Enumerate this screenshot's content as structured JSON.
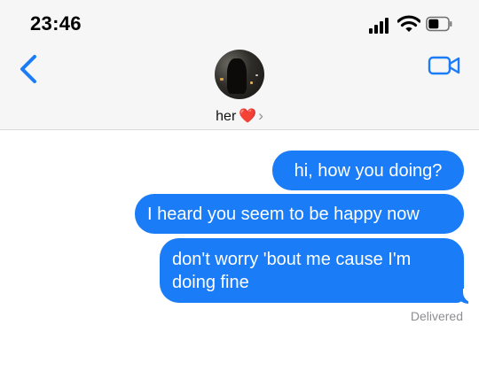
{
  "status_bar": {
    "time": "23:46",
    "icons": [
      "cellular-signal-icon",
      "wifi-icon",
      "battery-icon"
    ]
  },
  "header": {
    "back_icon": "chevron-left-icon",
    "contact_name": "her",
    "contact_emoji": "❤️",
    "chevron": "›",
    "video_icon": "video-camera-icon"
  },
  "messages": [
    {
      "from": "me",
      "text": "hi, how you doing?"
    },
    {
      "from": "me",
      "text": "I heard you seem to be happy now"
    },
    {
      "from": "me",
      "text": "don't worry 'bout me cause I'm doing fine"
    }
  ],
  "delivery_status": "Delivered",
  "colors": {
    "bubble": "#1a7cf6",
    "accent": "#1a7cf6",
    "header_bg": "#f6f6f7"
  }
}
